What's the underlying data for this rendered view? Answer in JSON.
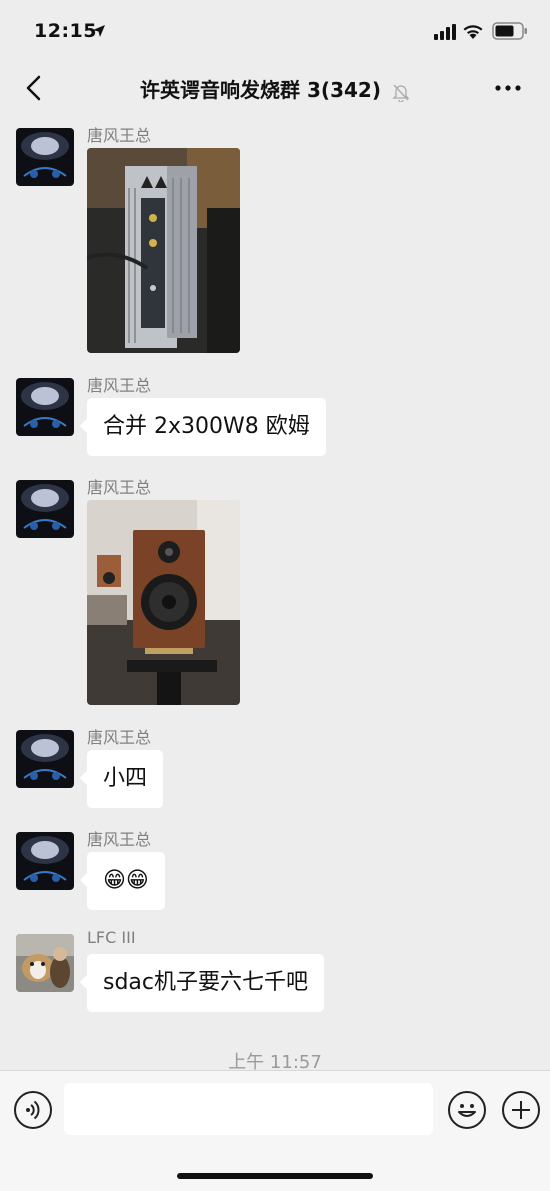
{
  "status_bar": {
    "time": "12:15"
  },
  "header": {
    "title": "许英谔音响发烧群 3(342)"
  },
  "messages": [
    {
      "sender": "唐风王总",
      "type": "image",
      "image": "amplifier-board-photo"
    },
    {
      "sender": "唐风王总",
      "type": "text",
      "text": "合并 2x300W8 欧姆"
    },
    {
      "sender": "唐风王总",
      "type": "image",
      "image": "bookshelf-speaker-photo"
    },
    {
      "sender": "唐风王总",
      "type": "text",
      "text": "小四"
    },
    {
      "sender": "唐风王总",
      "type": "text",
      "text": "😁😁"
    },
    {
      "sender": "LFC III",
      "type": "text",
      "text": "sdac机子要六七千吧"
    }
  ],
  "timestamp": "上午 11:57",
  "input": {
    "value": ""
  },
  "colors": {
    "background": "#ededed",
    "bubble": "#ffffff",
    "input_bar": "#f6f6f6"
  }
}
